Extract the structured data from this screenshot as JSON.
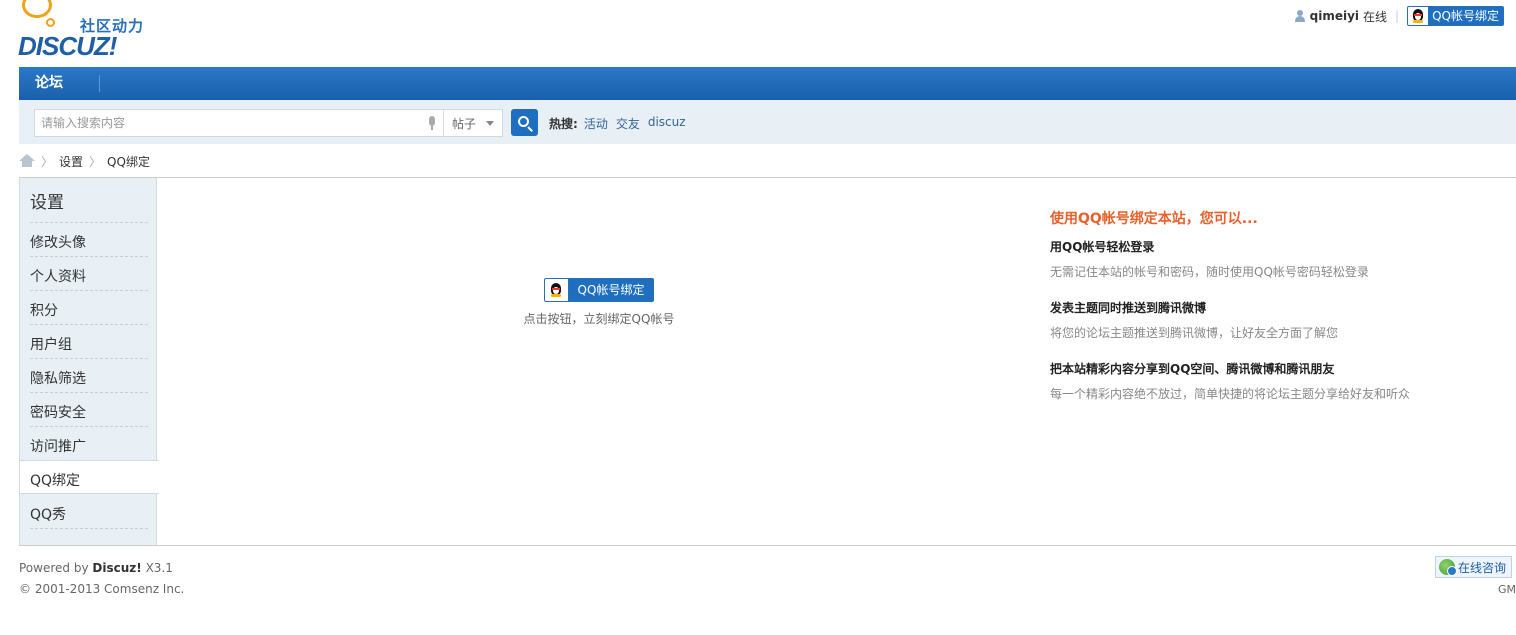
{
  "header": {
    "logo_cn": "社区动力",
    "logo_en": "DISCUZ!",
    "username": "qimeiyi",
    "status": "在线",
    "qq_bind_label": "QQ帐号绑定"
  },
  "nav": {
    "forum_label": "论坛"
  },
  "search": {
    "placeholder": "请输入搜索内容",
    "type_selected": "帖子",
    "hot_label": "热搜:",
    "hot_items": [
      "活动",
      "交友",
      "discuz"
    ]
  },
  "breadcrumb": {
    "items": [
      "设置",
      "QQ绑定"
    ]
  },
  "sidebar": {
    "title": "设置",
    "items": [
      {
        "label": "修改头像"
      },
      {
        "label": "个人资料"
      },
      {
        "label": "积分"
      },
      {
        "label": "用户组"
      },
      {
        "label": "隐私筛选"
      },
      {
        "label": "密码安全"
      },
      {
        "label": "访问推广"
      },
      {
        "label": "QQ绑定"
      },
      {
        "label": "QQ秀"
      }
    ],
    "active_index": 7
  },
  "bind": {
    "button_label": "QQ帐号绑定",
    "hint": "点击按钮，立刻绑定QQ帐号"
  },
  "benefits": {
    "headline": "使用QQ帐号绑定本站，您可以...",
    "items": [
      {
        "title": "用QQ帐号轻松登录",
        "desc": "无需记住本站的帐号和密码，随时使用QQ帐号密码轻松登录"
      },
      {
        "title": "发表主题同时推送到腾讯微博",
        "desc": "将您的论坛主题推送到腾讯微博，让好友全方面了解您"
      },
      {
        "title": "把本站精彩内容分享到QQ空间、腾讯微博和腾讯朋友",
        "desc": "每一个精彩内容绝不放过，简单快捷的将论坛主题分享给好友和听众"
      }
    ]
  },
  "footer": {
    "powered_prefix": "Powered by",
    "powered_brand": "Discuz!",
    "version": "X3.1",
    "copyright": "© 2001-2013 Comsenz Inc.",
    "consult_label": "在线咨询",
    "gm": "GM"
  },
  "colors": {
    "nav_blue": "#1e6fc0",
    "headline_orange": "#e8612c",
    "link_blue": "#336699"
  }
}
